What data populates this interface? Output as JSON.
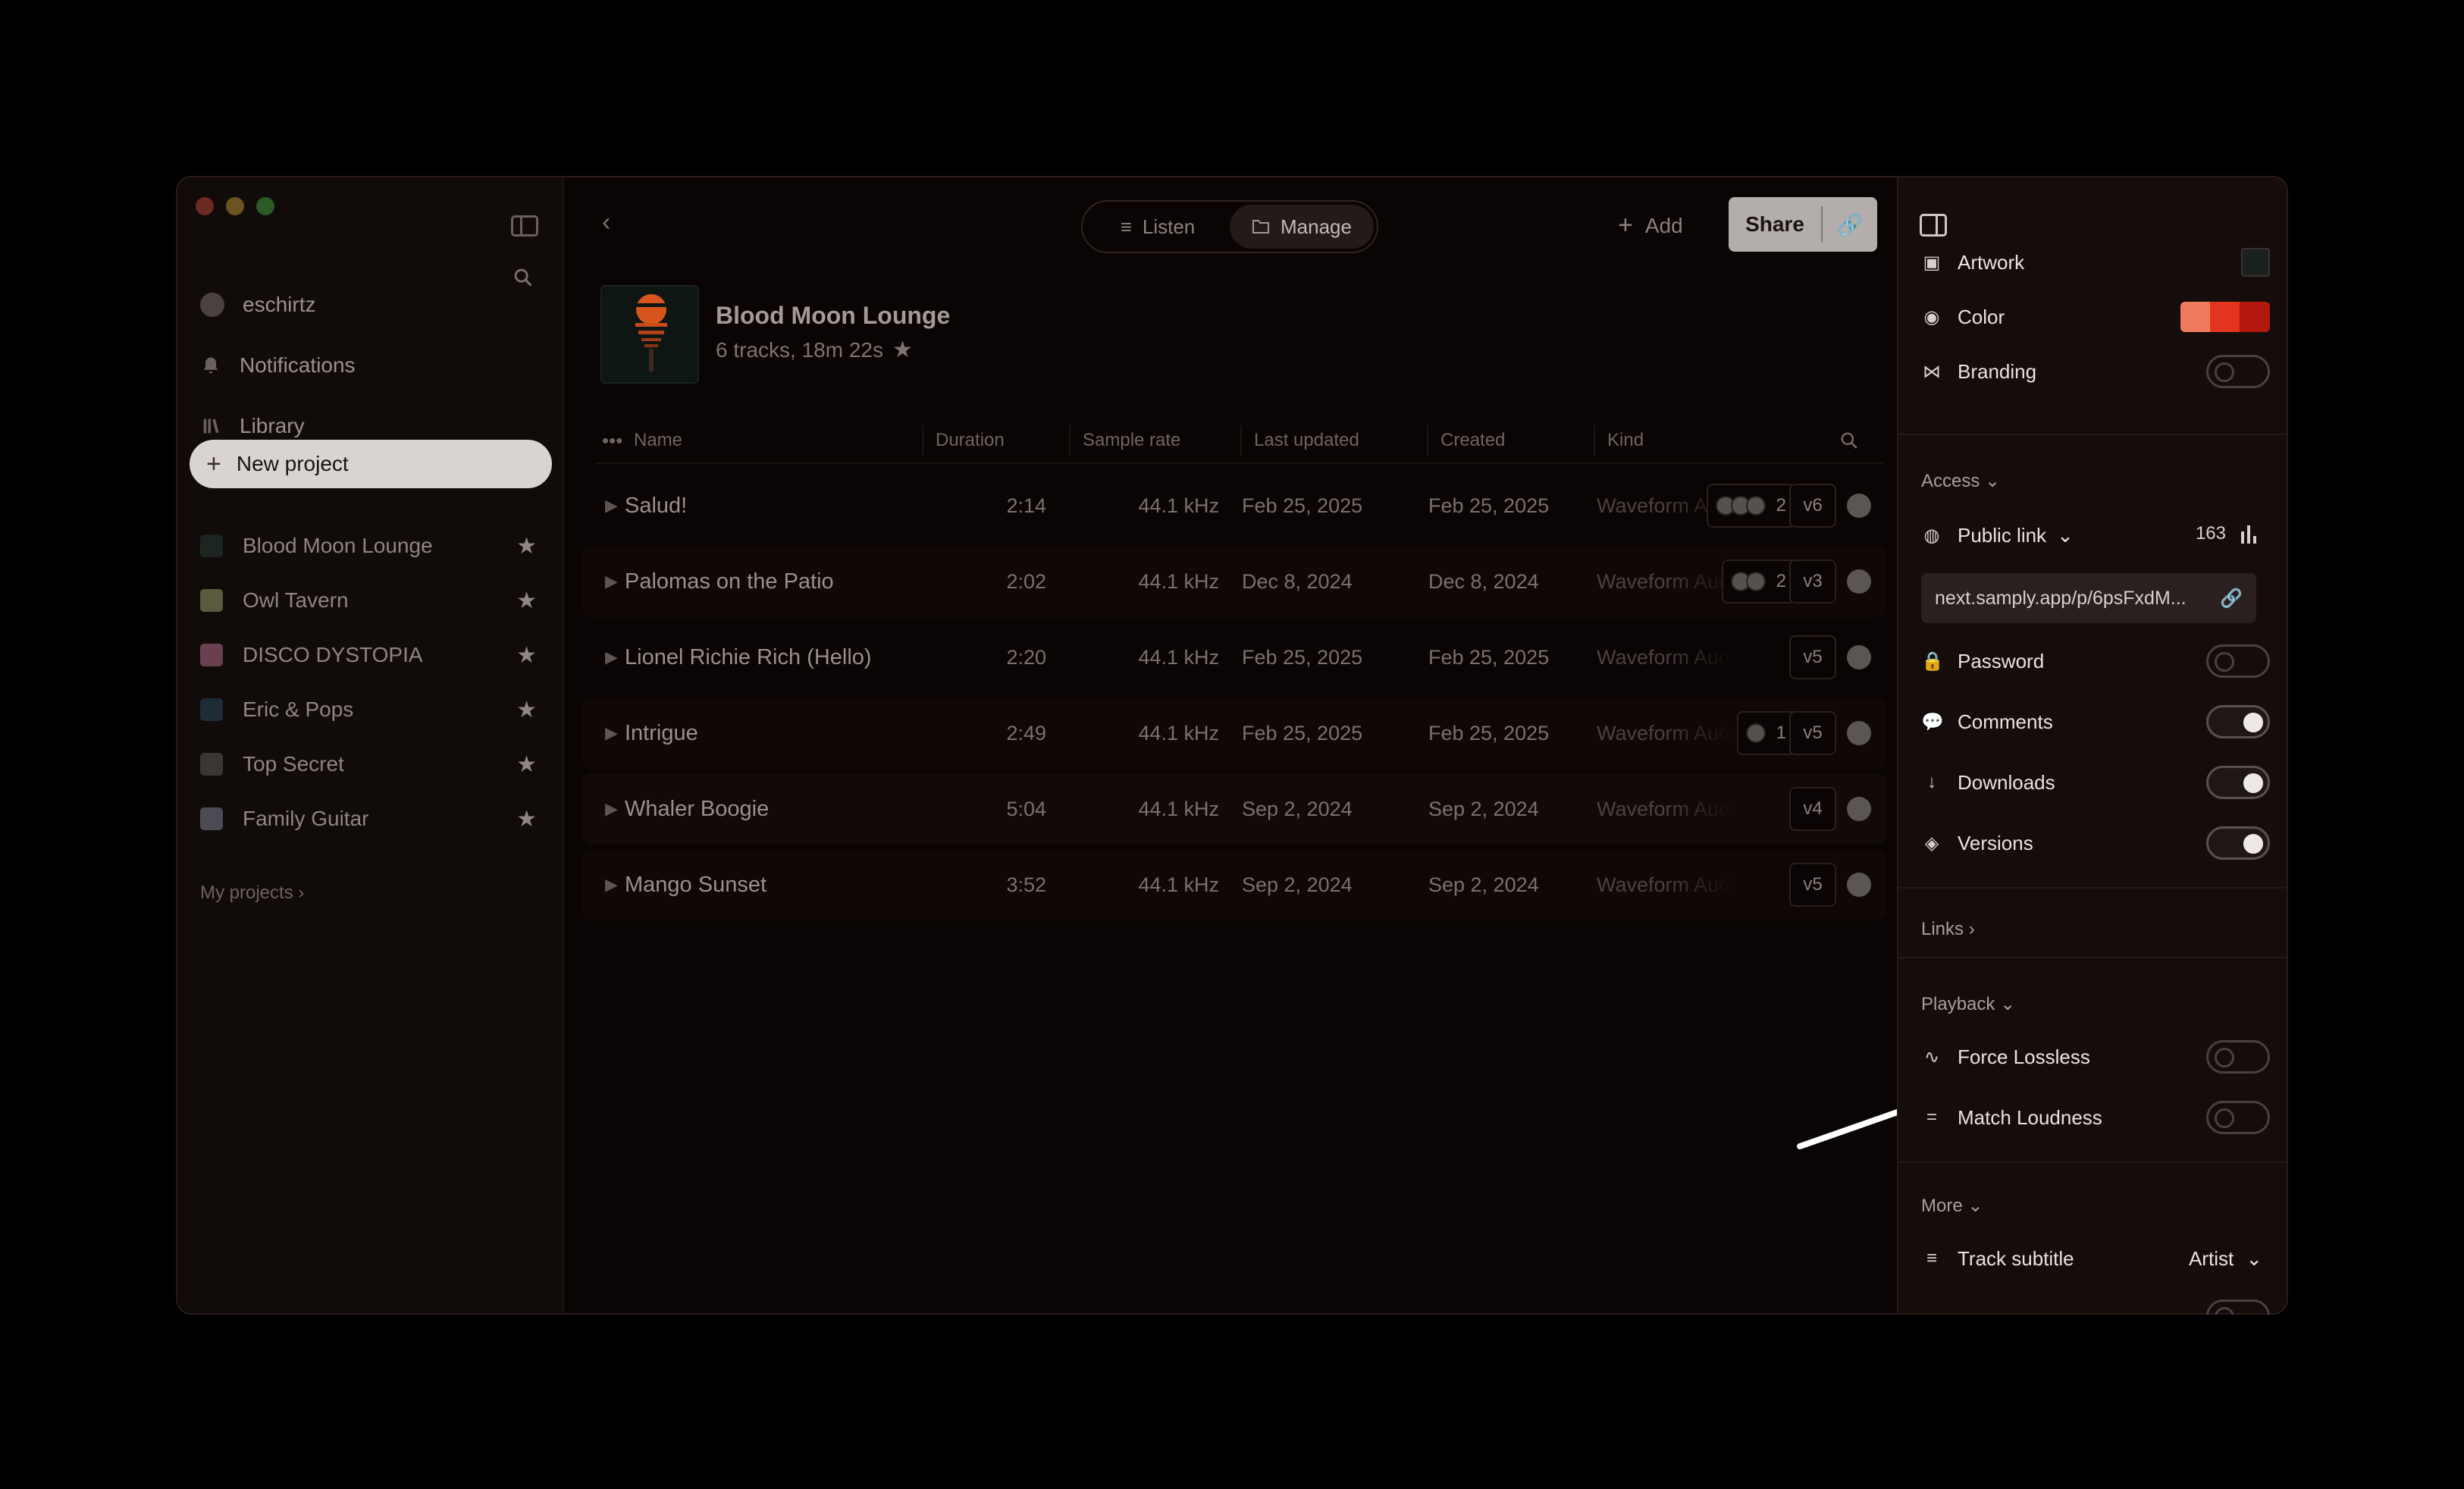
{
  "sidebar": {
    "user": "eschirtz",
    "nav": [
      {
        "label": "Notifications",
        "icon": "bell-icon"
      },
      {
        "label": "Library",
        "icon": "library-icon"
      }
    ],
    "new_project": "New project",
    "projects": [
      {
        "label": "Blood Moon Lounge",
        "color": "#c2541f"
      },
      {
        "label": "Owl Tavern",
        "color": "#6a5a3c"
      },
      {
        "label": "DISCO DYSTOPIA",
        "color": "#7a4a5a"
      },
      {
        "label": "Eric & Pops",
        "color": "#2a3a4a"
      },
      {
        "label": "Top Secret",
        "color": "#3a3a3a"
      },
      {
        "label": "Family Guitar",
        "color": "#5a5a6a"
      }
    ],
    "my_projects": "My projects"
  },
  "toolbar": {
    "listen": "Listen",
    "manage": "Manage",
    "add": "Add",
    "share": "Share"
  },
  "project": {
    "title": "Blood Moon Lounge",
    "subtitle": "6 tracks, 18m 22s"
  },
  "table": {
    "columns": [
      "Name",
      "Duration",
      "Sample rate",
      "Last updated",
      "Created",
      "Kind"
    ],
    "rows": [
      {
        "name": "Salud!",
        "duration": "2:14",
        "sample_rate": "44.1 kHz",
        "updated": "Feb 25, 2025",
        "created": "Feb 25, 2025",
        "kind": "Waveform Audio",
        "comments": "2",
        "version": "v6"
      },
      {
        "name": "Palomas on the Patio",
        "duration": "2:02",
        "sample_rate": "44.1 kHz",
        "updated": "Dec 8, 2024",
        "created": "Dec 8, 2024",
        "kind": "Waveform Audio",
        "comments": "2",
        "version": "v3"
      },
      {
        "name": "Lionel Richie Rich (Hello)",
        "duration": "2:20",
        "sample_rate": "44.1 kHz",
        "updated": "Feb 25, 2025",
        "created": "Feb 25, 2025",
        "kind": "Waveform Audio",
        "comments": "",
        "version": "v5"
      },
      {
        "name": "Intrigue",
        "duration": "2:49",
        "sample_rate": "44.1 kHz",
        "updated": "Feb 25, 2025",
        "created": "Feb 25, 2025",
        "kind": "Waveform Audio",
        "comments": "1",
        "version": "v5"
      },
      {
        "name": "Whaler Boogie",
        "duration": "5:04",
        "sample_rate": "44.1 kHz",
        "updated": "Sep 2, 2024",
        "created": "Sep 2, 2024",
        "kind": "Waveform Audio",
        "comments": "",
        "version": "v4"
      },
      {
        "name": "Mango Sunset",
        "duration": "3:52",
        "sample_rate": "44.1 kHz",
        "updated": "Sep 2, 2024",
        "created": "Sep 2, 2024",
        "kind": "Waveform Audio",
        "comments": "",
        "version": "v5"
      }
    ]
  },
  "panel": {
    "artwork": "Artwork",
    "color": "Color",
    "branding": "Branding",
    "access": "Access",
    "public_link": "Public link",
    "views": "163",
    "url": "next.samply.app/p/6psFxdM...",
    "password": "Password",
    "comments": "Comments",
    "downloads": "Downloads",
    "versions": "Versions",
    "links": "Links",
    "playback": "Playback",
    "force_lossless": "Force Lossless",
    "match_loudness": "Match Loudness",
    "more": "More",
    "track_subtitle": "Track subtitle",
    "track_subtitle_value": "Artist"
  }
}
